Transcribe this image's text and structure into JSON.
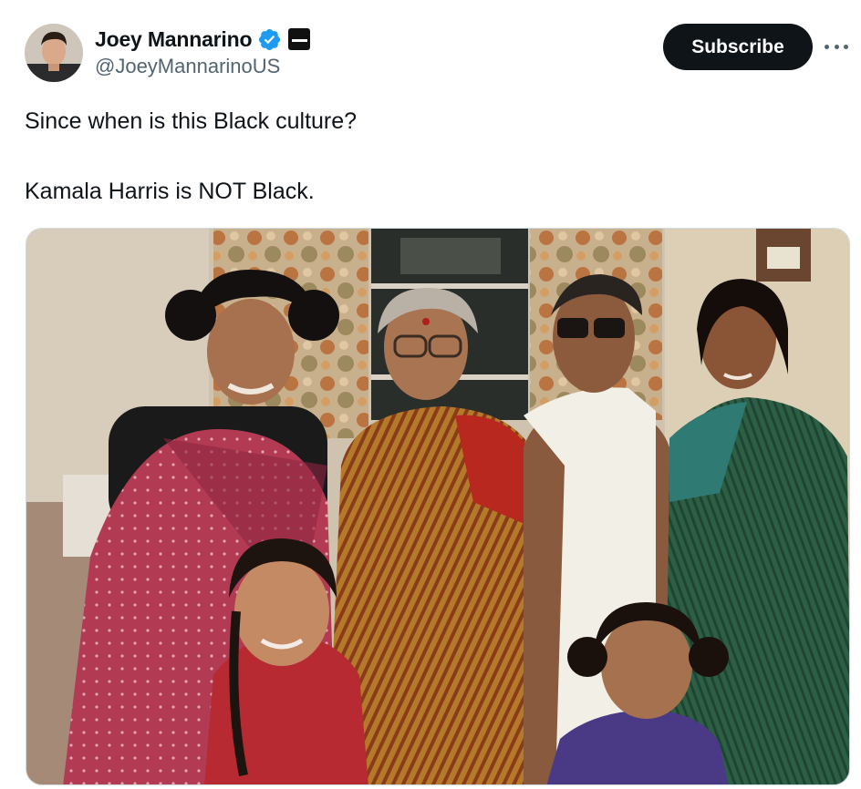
{
  "author": {
    "name": "Joey Mannarino",
    "handle": "@JoeyMannarinoUS",
    "verified_icon": "verified-badge-icon",
    "affiliation_icon": "affiliation-badge-icon"
  },
  "actions": {
    "subscribe_label": "Subscribe",
    "more_icon": "more-options-icon"
  },
  "tweet": {
    "line1": "Since when is this Black culture?",
    "line2": "Kamala Harris is NOT Black."
  },
  "colors": {
    "text": "#0f1419",
    "secondary": "#536471",
    "verified": "#1d9bf0",
    "button_bg": "#0f1419"
  }
}
